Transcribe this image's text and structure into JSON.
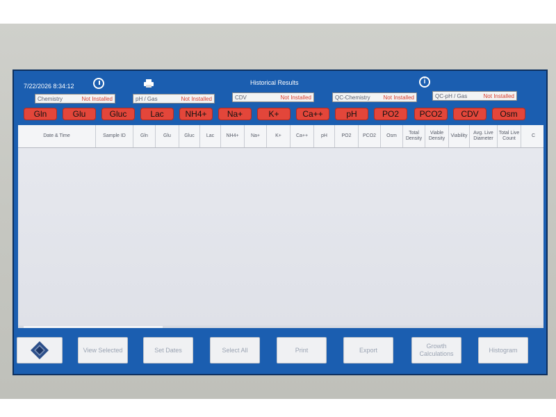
{
  "header": {
    "datetime": "7/22/2026  8:34:12",
    "title": "Historical Results"
  },
  "status": [
    {
      "label": "Chemistry",
      "value": "Not Installed"
    },
    {
      "label": "pH / Gas",
      "value": "Not Installed"
    },
    {
      "label": "CDV",
      "value": "Not Installed"
    },
    {
      "label": "QC-Chemistry",
      "value": "Not Installed"
    },
    {
      "label": "QC-pH / Gas",
      "value": "Not Installed"
    }
  ],
  "analytes": [
    "Gln",
    "Glu",
    "Gluc",
    "Lac",
    "NH4+",
    "Na+",
    "K+",
    "Ca++",
    "pH",
    "PO2",
    "PCO2",
    "CDV",
    "Osm"
  ],
  "columns": [
    "Date & Time",
    "Sample ID",
    "Gln",
    "Glu",
    "Gluc",
    "Lac",
    "NH4+",
    "Na+",
    "K+",
    "Ca++",
    "pH",
    "PO2",
    "PCO2",
    "Osm",
    "Total Density",
    "Viable Density",
    "Viability",
    "Avg. Live Diameter",
    "Total Live Count",
    "C"
  ],
  "buttons": {
    "view_selected": "View Selected",
    "set_dates": "Set Dates",
    "select_all": "Select All",
    "print": "Print",
    "export": "Export",
    "growth": "Growth Calculations",
    "histogram": "Histogram"
  },
  "colors": {
    "screen_bg": "#1b5eb0",
    "analyte_pill": "#e3463a",
    "not_installed": "#d93a2a"
  },
  "icons": [
    "clock-icon",
    "printer-icon",
    "info-icon",
    "home-logo-icon"
  ]
}
